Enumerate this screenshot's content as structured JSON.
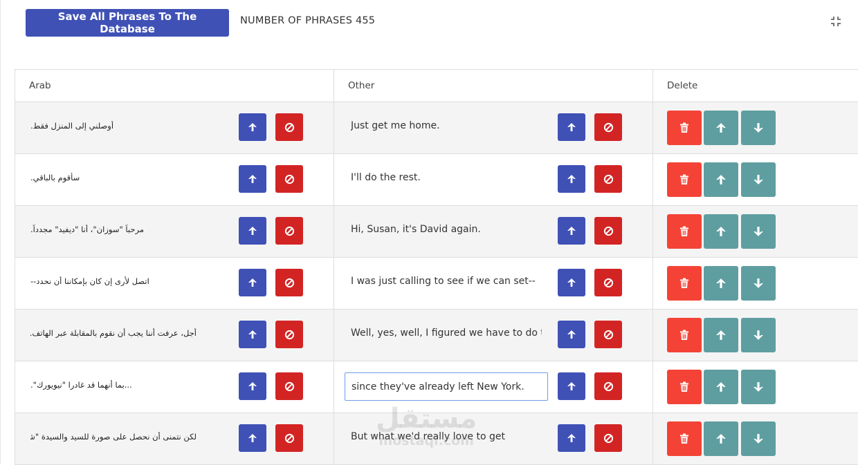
{
  "toolbar": {
    "save_label": "Save All Phrases To The Database",
    "count_label": "NUMBER OF PHRASES 455"
  },
  "icons": {
    "collapse": "collapse-icon",
    "move_up": "arrow-up-icon",
    "block": "block-icon",
    "delete": "trash-icon",
    "row_up": "arrow-up-icon",
    "row_down": "arrow-down-icon"
  },
  "colors": {
    "primary": "#3f51b5",
    "danger": "#d32424",
    "delete": "#f44336",
    "teal": "#5f9ea0"
  },
  "table": {
    "headers": [
      "Arab",
      "Other",
      "Delete"
    ],
    "rows": [
      {
        "arab": "أوصلني إلى المنزل فقط.",
        "other": "Just get me home."
      },
      {
        "arab": "سأقوم بالباقي.",
        "other": "I'll do the rest."
      },
      {
        "arab": "مرحباً \"سوزان\"، أنا \"ديفيد\" مجدداً.",
        "other": "Hi, Susan, it's David again."
      },
      {
        "arab": "اتصل لأرى إن كان بإمكاننا أن نحدد--",
        "other": "I was just calling to see if we can set--"
      },
      {
        "arab": "أجل، عرفت أننا يجب أن نقوم بالمقابلة عبر الهاتف...",
        "other": "Well, yes, well, I figured we have to do th"
      },
      {
        "arab": "...بما أنهما قد غادرا \"نيويورك\".",
        "other": "since they've already left New York."
      },
      {
        "arab": "لكن نتمنى أن نحصل على صورة للسيد والسيدة \"شوارتز\"...",
        "other": "But what we'd really love to get"
      }
    ]
  },
  "watermark": {
    "arabic": "مستقل",
    "latin": "mostaql.com"
  }
}
